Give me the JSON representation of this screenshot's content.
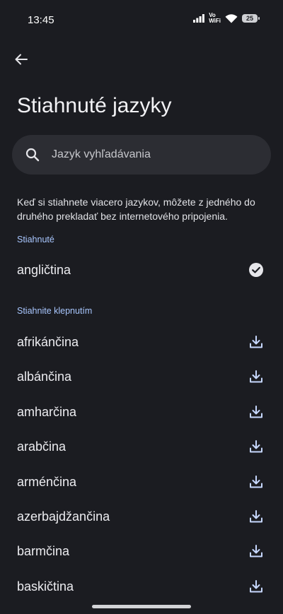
{
  "status": {
    "time": "13:45",
    "vowifi_line1": "Vo",
    "vowifi_line2": "WiFi",
    "battery": "25"
  },
  "header": {
    "title": "Stiahnuté jazyky"
  },
  "search": {
    "placeholder": "Jazyk vyhľadávania"
  },
  "info_text": "Keď si stiahnete viacero jazykov, môžete z jedného do druhého prekladať bez internetového pripojenia.",
  "downloaded": {
    "label": "Stiahnuté",
    "items": [
      {
        "name": "angličtina"
      }
    ]
  },
  "available": {
    "label": "Stiahnite klepnutím",
    "items": [
      {
        "name": "afrikánčina"
      },
      {
        "name": "albánčina"
      },
      {
        "name": "amharčina"
      },
      {
        "name": "arabčina"
      },
      {
        "name": "arménčina"
      },
      {
        "name": "azerbajdžančina"
      },
      {
        "name": "barmčina"
      },
      {
        "name": "baskičtina"
      }
    ]
  },
  "colors": {
    "background": "#1b1c21",
    "accent": "#a9c7ff",
    "icon_accent": "#c7d8ff"
  }
}
